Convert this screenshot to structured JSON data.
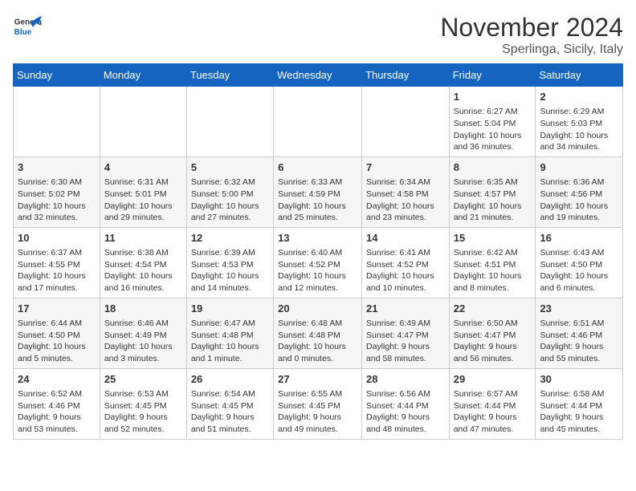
{
  "logo": {
    "line1": "General",
    "line2": "Blue"
  },
  "title": "November 2024",
  "location": "Sperlinga, Sicily, Italy",
  "days_of_week": [
    "Sunday",
    "Monday",
    "Tuesday",
    "Wednesday",
    "Thursday",
    "Friday",
    "Saturday"
  ],
  "weeks": [
    [
      {
        "num": "",
        "details": ""
      },
      {
        "num": "",
        "details": ""
      },
      {
        "num": "",
        "details": ""
      },
      {
        "num": "",
        "details": ""
      },
      {
        "num": "",
        "details": ""
      },
      {
        "num": "1",
        "details": "Sunrise: 6:27 AM\nSunset: 5:04 PM\nDaylight: 10 hours and 36 minutes."
      },
      {
        "num": "2",
        "details": "Sunrise: 6:29 AM\nSunset: 5:03 PM\nDaylight: 10 hours and 34 minutes."
      }
    ],
    [
      {
        "num": "3",
        "details": "Sunrise: 6:30 AM\nSunset: 5:02 PM\nDaylight: 10 hours and 32 minutes."
      },
      {
        "num": "4",
        "details": "Sunrise: 6:31 AM\nSunset: 5:01 PM\nDaylight: 10 hours and 29 minutes."
      },
      {
        "num": "5",
        "details": "Sunrise: 6:32 AM\nSunset: 5:00 PM\nDaylight: 10 hours and 27 minutes."
      },
      {
        "num": "6",
        "details": "Sunrise: 6:33 AM\nSunset: 4:59 PM\nDaylight: 10 hours and 25 minutes."
      },
      {
        "num": "7",
        "details": "Sunrise: 6:34 AM\nSunset: 4:58 PM\nDaylight: 10 hours and 23 minutes."
      },
      {
        "num": "8",
        "details": "Sunrise: 6:35 AM\nSunset: 4:57 PM\nDaylight: 10 hours and 21 minutes."
      },
      {
        "num": "9",
        "details": "Sunrise: 6:36 AM\nSunset: 4:56 PM\nDaylight: 10 hours and 19 minutes."
      }
    ],
    [
      {
        "num": "10",
        "details": "Sunrise: 6:37 AM\nSunset: 4:55 PM\nDaylight: 10 hours and 17 minutes."
      },
      {
        "num": "11",
        "details": "Sunrise: 6:38 AM\nSunset: 4:54 PM\nDaylight: 10 hours and 16 minutes."
      },
      {
        "num": "12",
        "details": "Sunrise: 6:39 AM\nSunset: 4:53 PM\nDaylight: 10 hours and 14 minutes."
      },
      {
        "num": "13",
        "details": "Sunrise: 6:40 AM\nSunset: 4:52 PM\nDaylight: 10 hours and 12 minutes."
      },
      {
        "num": "14",
        "details": "Sunrise: 6:41 AM\nSunset: 4:52 PM\nDaylight: 10 hours and 10 minutes."
      },
      {
        "num": "15",
        "details": "Sunrise: 6:42 AM\nSunset: 4:51 PM\nDaylight: 10 hours and 8 minutes."
      },
      {
        "num": "16",
        "details": "Sunrise: 6:43 AM\nSunset: 4:50 PM\nDaylight: 10 hours and 6 minutes."
      }
    ],
    [
      {
        "num": "17",
        "details": "Sunrise: 6:44 AM\nSunset: 4:50 PM\nDaylight: 10 hours and 5 minutes."
      },
      {
        "num": "18",
        "details": "Sunrise: 6:46 AM\nSunset: 4:49 PM\nDaylight: 10 hours and 3 minutes."
      },
      {
        "num": "19",
        "details": "Sunrise: 6:47 AM\nSunset: 4:48 PM\nDaylight: 10 hours and 1 minute."
      },
      {
        "num": "20",
        "details": "Sunrise: 6:48 AM\nSunset: 4:48 PM\nDaylight: 10 hours and 0 minutes."
      },
      {
        "num": "21",
        "details": "Sunrise: 6:49 AM\nSunset: 4:47 PM\nDaylight: 9 hours and 58 minutes."
      },
      {
        "num": "22",
        "details": "Sunrise: 6:50 AM\nSunset: 4:47 PM\nDaylight: 9 hours and 56 minutes."
      },
      {
        "num": "23",
        "details": "Sunrise: 6:51 AM\nSunset: 4:46 PM\nDaylight: 9 hours and 55 minutes."
      }
    ],
    [
      {
        "num": "24",
        "details": "Sunrise: 6:52 AM\nSunset: 4:46 PM\nDaylight: 9 hours and 53 minutes."
      },
      {
        "num": "25",
        "details": "Sunrise: 6:53 AM\nSunset: 4:45 PM\nDaylight: 9 hours and 52 minutes."
      },
      {
        "num": "26",
        "details": "Sunrise: 6:54 AM\nSunset: 4:45 PM\nDaylight: 9 hours and 51 minutes."
      },
      {
        "num": "27",
        "details": "Sunrise: 6:55 AM\nSunset: 4:45 PM\nDaylight: 9 hours and 49 minutes."
      },
      {
        "num": "28",
        "details": "Sunrise: 6:56 AM\nSunset: 4:44 PM\nDaylight: 9 hours and 48 minutes."
      },
      {
        "num": "29",
        "details": "Sunrise: 6:57 AM\nSunset: 4:44 PM\nDaylight: 9 hours and 47 minutes."
      },
      {
        "num": "30",
        "details": "Sunrise: 6:58 AM\nSunset: 4:44 PM\nDaylight: 9 hours and 45 minutes."
      }
    ]
  ]
}
